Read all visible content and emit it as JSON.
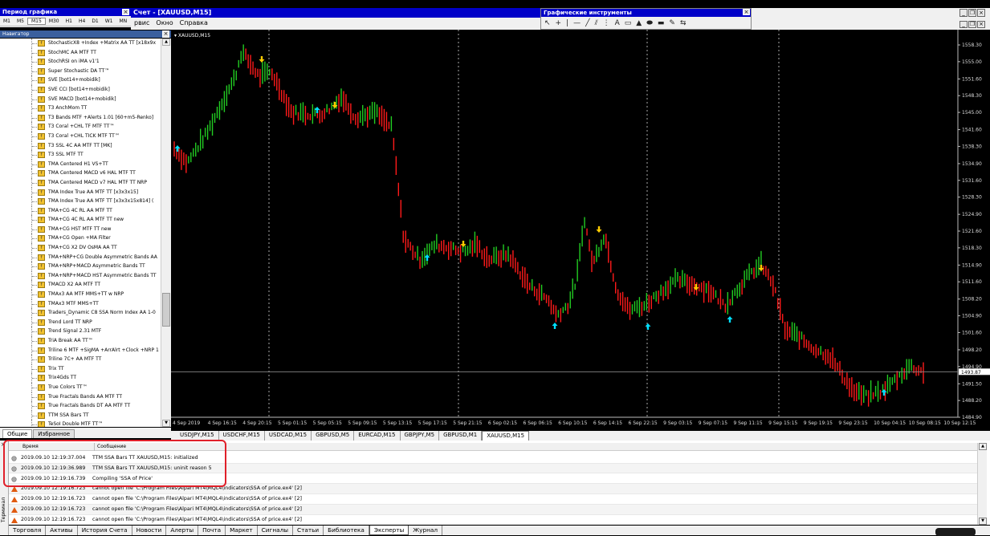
{
  "timeframe_panel": {
    "title": "Период графика",
    "periods": [
      "M1",
      "M5",
      "M15",
      "M30",
      "H1",
      "H4",
      "D1",
      "W1",
      "MN"
    ],
    "selected": "M15"
  },
  "window": {
    "title": "Счет - [XAUUSD,M15]",
    "menu": [
      "рвис",
      "Окно",
      "Справка"
    ]
  },
  "graphics_tools": {
    "title": "Графические инструменты",
    "icons": [
      "cursor-icon",
      "crosshair-icon",
      "vline-icon",
      "hline-icon",
      "trendline-icon",
      "channel-icon",
      "fibo-icon",
      "text-icon",
      "label-icon",
      "triangle-icon",
      "ellipse-icon",
      "rectangle-icon",
      "pencil-icon",
      "arrow-icon"
    ]
  },
  "navigator": {
    "title": "Навигатор",
    "items": [
      "StochasticX8 +Index +Matrix AA TT [x18x9x",
      "StochMC AA MTF TT",
      "StochRSI on iMA v1'1",
      "Super Stochastic DA TT™",
      "SVE [bot14+mobidik]",
      "SVE CCI [bot14+mobidik]",
      "SVE MACD [bot14+mobidik]",
      "T3 AnchMom TT",
      "T3 Bands MTF +Alerts 1.01 [60+m5-Renko]",
      "T3 Coral +CHL TF MTF TT™",
      "T3 Coral +CHL TICK MTF TT™",
      "T3 SSL 4C AA MTF TT [MK]",
      "T3 SSL MTF TT",
      "TMA Centered H1 VS+TT",
      "TMA Centered MACD v6 HAL MTF TT",
      "TMA Centered MACD v7 HAL MTF TT NRP",
      "TMA Index True AA MTF TT [x3x3x15]",
      "TMA Index True AA MTF TT [x3x3x15x814] (",
      "TMA+CG 4C RL AA MTF TT",
      "TMA+CG 4C RL AA MTF TT new",
      "TMA+CG HST MTF TT new",
      "TMA+CG Open +MA Filter",
      "TMA+CG X2 DV OsMA AA TT",
      "TMA+NRP+CG Double Asymmetric Bands AA",
      "TMA+NRP+MACD Asymmetric Bands TT",
      "TMA+NRP+MACD HST Asymmetric Bands TT",
      "TMACD X2 AA MTF TT",
      "TMAx3 AA MTF MMS+TT w NRP",
      "TMAx3 MTF MMS+TT",
      "Traders_Dynamic C8 SSA Norm Index AA 1-0",
      "Trend Lord TT NRP",
      "Trend Signal 2.31 MTF",
      "TriA Break AA TT™",
      "Triline 6 MTF +SigMA +ArrAlrt +Clock +NRP 1",
      "Triline 7C+ AA MTF TT",
      "Trix TT",
      "Trix4Gds TT",
      "True Colors TT™",
      "True Fractals Bands AA MTF TT",
      "True Fractals Bands DT AA MTF TT",
      "TTM SSA Bars TT",
      "TeSoI Double MTF TT™"
    ],
    "tabs": [
      "Общие",
      "Избранное"
    ]
  },
  "chart": {
    "symbol_label": "XAUUSD,M15",
    "price_axis": [
      "1558.30",
      "1555.00",
      "1551.60",
      "1548.30",
      "1545.00",
      "1541.60",
      "1538.30",
      "1534.90",
      "1531.60",
      "1528.30",
      "1524.90",
      "1521.60",
      "1518.30",
      "1514.90",
      "1511.60",
      "1508.20",
      "1504.90",
      "1501.60",
      "1498.20",
      "1494.90",
      "1491.50",
      "1488.20",
      "1484.90"
    ],
    "current_price": "1493.87",
    "time_axis": [
      "4 Sep 2019",
      "4 Sep 16:15",
      "4 Sep 20:15",
      "5 Sep 01:15",
      "5 Sep 05:15",
      "5 Sep 09:15",
      "5 Sep 13:15",
      "5 Sep 17:15",
      "5 Sep 21:15",
      "6 Sep 02:15",
      "6 Sep 06:15",
      "6 Sep 10:15",
      "6 Sep 14:15",
      "6 Sep 22:15",
      "9 Sep 03:15",
      "9 Sep 07:15",
      "9 Sep 11:15",
      "9 Sep 15:15",
      "9 Sep 19:15",
      "9 Sep 23:15",
      "10 Sep 04:15",
      "10 Sep 08:15",
      "10 Sep 12:15"
    ],
    "colors": {
      "up": "#22cc22",
      "down": "#ff1a1a",
      "buy_arrow": "#00e0ff",
      "sell_arrow": "#ffcc00",
      "bg": "#000000"
    }
  },
  "chart_tabs": {
    "items": [
      "USDJPY,M15",
      "USDCHF,M15",
      "USDCAD,M15",
      "GBPUSD,M5",
      "EURCAD,M15",
      "GBPJPY,M5",
      "GBPUSD,M1",
      "XAUUSD,M15"
    ],
    "selected": "XAUUSD,M15"
  },
  "terminal": {
    "headers": {
      "time": "Время",
      "message": "Сообщение"
    },
    "rows": [
      {
        "type": "info",
        "time": "2019.09.10 12:19:37.004",
        "message": "TTM SSA Bars TT XAUUSD,M15: initialized"
      },
      {
        "type": "info",
        "time": "2019.09.10 12:19:36.989",
        "message": "TTM SSA Bars TT XAUUSD,M15: uninit reason 5"
      },
      {
        "type": "info",
        "time": "2019.09.10 12:19:16.739",
        "message": "Compiling 'SSA of Price'"
      },
      {
        "type": "warning",
        "time": "2019.09.10 12:19:16.723",
        "message": "cannot open file 'C:\\Program Files\\Alpari MT4\\MQL4\\indicators\\SSA of price.ex4' [2]"
      },
      {
        "type": "warning",
        "time": "2019.09.10 12:19:16.723",
        "message": "cannot open file 'C:\\Program Files\\Alpari MT4\\MQL4\\indicators\\SSA of price.ex4' [2]"
      },
      {
        "type": "warning",
        "time": "2019.09.10 12:19:16.723",
        "message": "cannot open file 'C:\\Program Files\\Alpari MT4\\MQL4\\indicators\\SSA of price.ex4' [2]"
      },
      {
        "type": "warning",
        "time": "2019.09.10 12:19:16.723",
        "message": "cannot open file 'C:\\Program Files\\Alpari MT4\\MQL4\\indicators\\SSA of price.ex4' [2]"
      }
    ],
    "side_label": "Терминал",
    "tabs": [
      "Торговля",
      "Активы",
      "История Счета",
      "Новости",
      "Алерты",
      "Почта",
      "Маркет",
      "Сигналы",
      "Статьи",
      "Библиотека",
      "Эксперты",
      "Журнал"
    ],
    "selected_tab": "Эксперты"
  }
}
